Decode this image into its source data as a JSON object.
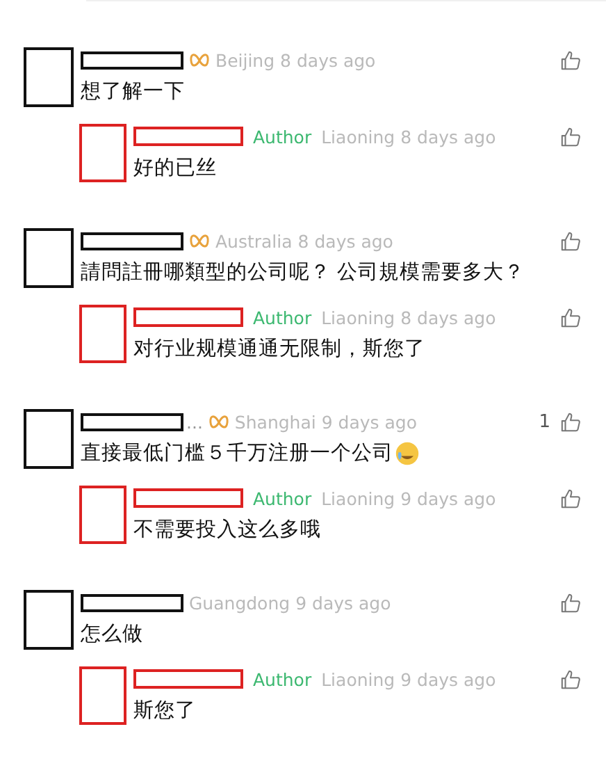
{
  "comments": [
    {
      "badge": true,
      "location": "Beijing",
      "time": "8 days ago",
      "text": "想了解一下",
      "reply": {
        "author_label": "Author",
        "location": "Liaoning",
        "time": "8 days ago",
        "text": "好的已丝"
      }
    },
    {
      "badge": true,
      "location": "Australia",
      "time": "8 days ago",
      "text": "請問註冊哪類型的公司呢？ 公司規模需要多大？",
      "reply": {
        "author_label": "Author",
        "location": "Liaoning",
        "time": "8 days ago",
        "text": "对行业规模通通无限制，斯您了"
      }
    },
    {
      "badge": true,
      "name_suffix": "...",
      "location": "Shanghai",
      "time": "9 days ago",
      "likes": "1",
      "emoji": true,
      "text": "直接最低门槛５千万注册一个公司",
      "reply": {
        "author_label": "Author",
        "location": "Liaoning",
        "time": "9 days ago",
        "text": "不需要投入这么多哦"
      }
    },
    {
      "badge": false,
      "location": "Guangdong",
      "time": "9 days ago",
      "text": "怎么做",
      "reply": {
        "author_label": "Author",
        "location": "Liaoning",
        "time": "9 days ago",
        "text": "斯您了"
      }
    }
  ]
}
